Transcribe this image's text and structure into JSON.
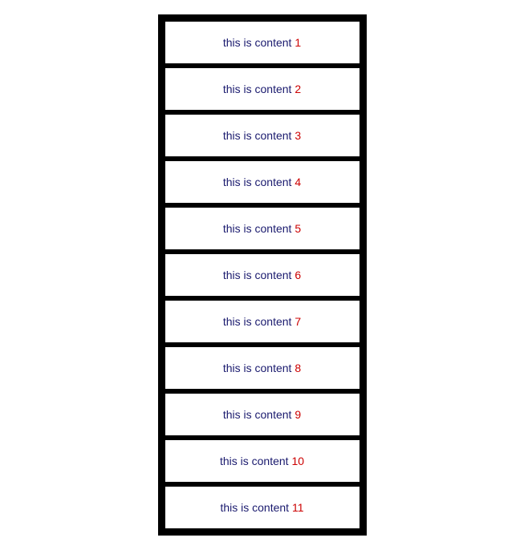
{
  "items": [
    {
      "id": 1,
      "label": "this is content ",
      "num": "1"
    },
    {
      "id": 2,
      "label": "this is content ",
      "num": "2"
    },
    {
      "id": 3,
      "label": "this is content ",
      "num": "3"
    },
    {
      "id": 4,
      "label": "this is content ",
      "num": "4"
    },
    {
      "id": 5,
      "label": "this is content ",
      "num": "5"
    },
    {
      "id": 6,
      "label": "this is content ",
      "num": "6"
    },
    {
      "id": 7,
      "label": "this is content ",
      "num": "7"
    },
    {
      "id": 8,
      "label": "this is content ",
      "num": "8"
    },
    {
      "id": 9,
      "label": "this is content ",
      "num": "9"
    },
    {
      "id": 10,
      "label": "this is content ",
      "num": "10"
    },
    {
      "id": 11,
      "label": "this is content ",
      "num": "11"
    }
  ]
}
